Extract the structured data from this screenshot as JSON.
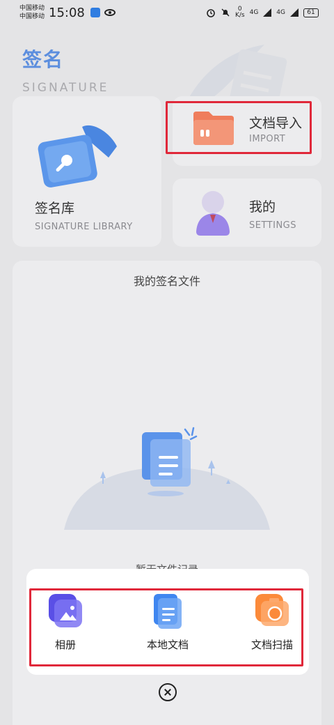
{
  "status_bar": {
    "carrier_1": "中国移动",
    "carrier_2": "中国移动",
    "time": "15:08",
    "net_speed_value": "0",
    "net_speed_unit": "K/s",
    "signal_1": "4G",
    "signal_2": "4G",
    "battery": "61"
  },
  "header": {
    "title": "签名",
    "subtitle": "SIGNATURE"
  },
  "cards": {
    "library": {
      "title": "签名库",
      "subtitle": "SIGNATURE LIBRARY",
      "icon": "pen-nib-icon"
    },
    "import": {
      "title": "文档导入",
      "subtitle": "IMPORT",
      "icon": "folder-icon"
    },
    "settings": {
      "title": "我的",
      "subtitle": "SETTINGS",
      "icon": "user-icon"
    }
  },
  "files_panel": {
    "title": "我的签名文件",
    "empty_text": "暂无文件记录",
    "illustration": "empty-document-icon"
  },
  "action_sheet": {
    "options": [
      {
        "label": "相册",
        "icon": "photo-album-icon"
      },
      {
        "label": "本地文档",
        "icon": "document-icon"
      },
      {
        "label": "文档扫描",
        "icon": "camera-icon"
      }
    ],
    "close_icon": "close-circle-icon"
  },
  "colors": {
    "accent_blue": "#5c8ede",
    "highlight_red": "#e0283a",
    "folder_orange": "#ef7d5c",
    "album_purple": "#6a5cf0",
    "doc_blue": "#3f86f0",
    "camera_orange": "#fb8a3a"
  }
}
